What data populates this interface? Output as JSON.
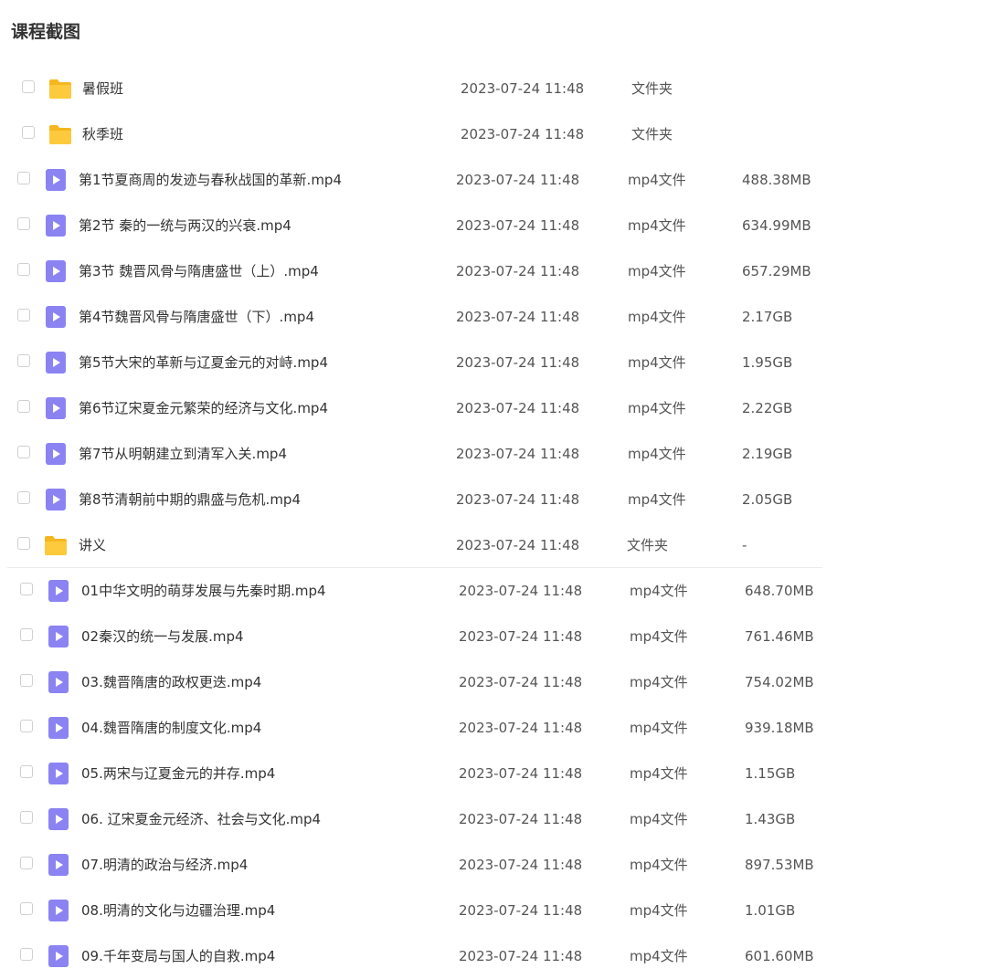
{
  "page": {
    "title": "课程截图"
  },
  "files": [
    {
      "name": "暑假班",
      "date": "2023-07-24 11:48",
      "type": "文件夹",
      "size": "",
      "kind": "folder"
    },
    {
      "name": "秋季班",
      "date": "2023-07-24 11:48",
      "type": "文件夹",
      "size": "",
      "kind": "folder"
    },
    {
      "name": "第1节夏商周的发迹与春秋战国的革新.mp4",
      "date": "2023-07-24 11:48",
      "type": "mp4文件",
      "size": "488.38MB",
      "kind": "video"
    },
    {
      "name": "第2节 秦的一统与两汉的兴衰.mp4",
      "date": "2023-07-24 11:48",
      "type": "mp4文件",
      "size": "634.99MB",
      "kind": "video"
    },
    {
      "name": "第3节 魏晋风骨与隋唐盛世（上）.mp4",
      "date": "2023-07-24 11:48",
      "type": "mp4文件",
      "size": "657.29MB",
      "kind": "video"
    },
    {
      "name": "第4节魏晋风骨与隋唐盛世（下）.mp4",
      "date": "2023-07-24 11:48",
      "type": "mp4文件",
      "size": "2.17GB",
      "kind": "video"
    },
    {
      "name": "第5节大宋的革新与辽夏金元的对峙.mp4",
      "date": "2023-07-24 11:48",
      "type": "mp4文件",
      "size": "1.95GB",
      "kind": "video"
    },
    {
      "name": "第6节辽宋夏金元繁荣的经济与文化.mp4",
      "date": "2023-07-24 11:48",
      "type": "mp4文件",
      "size": "2.22GB",
      "kind": "video"
    },
    {
      "name": "第7节从明朝建立到清军入关.mp4",
      "date": "2023-07-24 11:48",
      "type": "mp4文件",
      "size": "2.19GB",
      "kind": "video"
    },
    {
      "name": "第8节清朝前中期的鼎盛与危机.mp4",
      "date": "2023-07-24 11:48",
      "type": "mp4文件",
      "size": "2.05GB",
      "kind": "video"
    },
    {
      "name": "讲义",
      "date": "2023-07-24 11:48",
      "type": "文件夹",
      "size": "-",
      "kind": "folder"
    },
    {
      "name": "01中华文明的萌芽发展与先秦时期.mp4",
      "date": "2023-07-24 11:48",
      "type": "mp4文件",
      "size": "648.70MB",
      "kind": "video"
    },
    {
      "name": "02秦汉的统一与发展.mp4",
      "date": "2023-07-24 11:48",
      "type": "mp4文件",
      "size": "761.46MB",
      "kind": "video"
    },
    {
      "name": "03.魏晋隋唐的政权更迭.mp4",
      "date": "2023-07-24 11:48",
      "type": "mp4文件",
      "size": "754.02MB",
      "kind": "video"
    },
    {
      "name": "04.魏晋隋唐的制度文化.mp4",
      "date": "2023-07-24 11:48",
      "type": "mp4文件",
      "size": "939.18MB",
      "kind": "video"
    },
    {
      "name": "05.两宋与辽夏金元的并存.mp4",
      "date": "2023-07-24 11:48",
      "type": "mp4文件",
      "size": "1.15GB",
      "kind": "video"
    },
    {
      "name": "06. 辽宋夏金元经济、社会与文化.mp4",
      "date": "2023-07-24 11:48",
      "type": "mp4文件",
      "size": "1.43GB",
      "kind": "video"
    },
    {
      "name": "07.明清的政治与经济.mp4",
      "date": "2023-07-24 11:48",
      "type": "mp4文件",
      "size": "897.53MB",
      "kind": "video"
    },
    {
      "name": "08.明清的文化与边疆治理.mp4",
      "date": "2023-07-24 11:48",
      "type": "mp4文件",
      "size": "1.01GB",
      "kind": "video"
    },
    {
      "name": "09.千年变局与国人的自救.mp4",
      "date": "2023-07-24 11:48",
      "type": "mp4文件",
      "size": "601.60MB",
      "kind": "video"
    }
  ],
  "colors": {
    "folder": "#f8c233",
    "video": "#8b83f2"
  }
}
